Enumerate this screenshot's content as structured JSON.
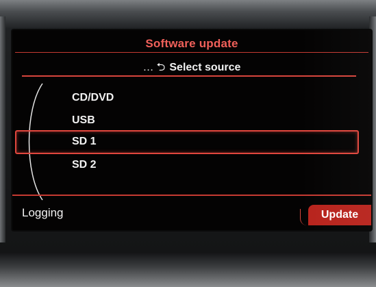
{
  "header": {
    "title": "Software update",
    "breadcrumb_prefix": "…",
    "subtitle": "Select source"
  },
  "menu": {
    "items": [
      {
        "label": "CD/DVD",
        "selected": false
      },
      {
        "label": "USB",
        "selected": false
      },
      {
        "label": "SD 1",
        "selected": true
      },
      {
        "label": "SD 2",
        "selected": false
      }
    ]
  },
  "softkeys": {
    "left": "Logging",
    "right": "Update"
  },
  "icons": {
    "back": "back-arrow-icon",
    "scroll": "scroll-arc-icon"
  },
  "colors": {
    "accent": "#e0463d",
    "title": "#f0605a",
    "text": "#f2f2f2",
    "background": "#040303",
    "softkey_active": "#b8241d"
  }
}
